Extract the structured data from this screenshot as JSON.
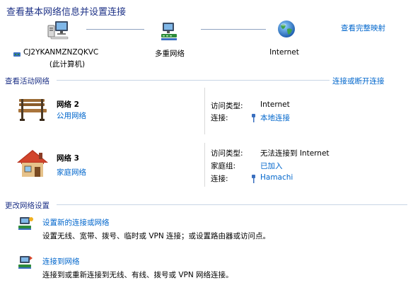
{
  "header": {
    "title": "查看基本网络信息并设置连接",
    "full_map_link": "查看完整映射"
  },
  "map": {
    "computer_name": "CJ2YKANMZNZQKVC",
    "computer_sub": "(此计算机)",
    "middle_label": "多重网络",
    "internet_label": "Internet"
  },
  "active": {
    "heading": "查看活动网络",
    "connect_link": "连接或断开连接",
    "networks": [
      {
        "name": "网络  2",
        "type": "公用网络",
        "access_type_label": "访问类型:",
        "access_type_value": "Internet",
        "connection_label": "连接:",
        "connection_value": "本地连接"
      },
      {
        "name": "网络  3",
        "type": "家庭网络",
        "access_type_label": "访问类型:",
        "access_type_value": "无法连接到 Internet",
        "homegroup_label": "家庭组:",
        "homegroup_value": "已加入",
        "connection_label": "连接:",
        "connection_value": "Hamachi"
      }
    ]
  },
  "settings": {
    "heading": "更改网络设置",
    "items": [
      {
        "title": "设置新的连接或网络",
        "desc": "设置无线、宽带、拨号、临时或 VPN 连接；或设置路由器或访问点。"
      },
      {
        "title": "连接到网络",
        "desc": "连接到或重新连接到无线、有线、拨号或 VPN 网络连接。"
      }
    ]
  },
  "colors": {
    "title": "#1e3287",
    "link": "#0066cc",
    "separator": "#c9d6e6"
  },
  "icons": [
    "computer-icon",
    "network-hub-icon",
    "globe-icon",
    "bench-icon",
    "house-icon",
    "wired-connection-icon",
    "setup-connection-icon",
    "connect-network-icon"
  ]
}
